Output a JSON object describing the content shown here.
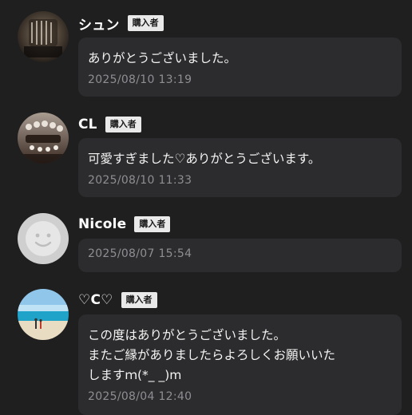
{
  "reviews": [
    {
      "user": "シュン",
      "badge": "購入者",
      "message": "ありがとうございました。",
      "timestamp": "2025/08/10 13:19",
      "avatar": "photo-icon"
    },
    {
      "user": "CL",
      "badge": "購入者",
      "message": "可愛すぎました♡ありがとうございます。",
      "timestamp": "2025/08/10 11:33",
      "avatar": "photo-icon"
    },
    {
      "user": "Nicole",
      "badge": "購入者",
      "message": "",
      "timestamp": "2025/08/07 15:54",
      "avatar": "default-avatar-icon"
    },
    {
      "user": "♡C♡",
      "badge": "購入者",
      "message": "この度はありがとうございました。\nまたご縁がありましたらよろしくお願いいた\nしますｍ(*_ _)m",
      "timestamp": "2025/08/04 12:40",
      "avatar": "beach-photo-icon"
    }
  ],
  "colors": {
    "background": "#1f1f1f",
    "bubble": "#2c2c2e",
    "badge": "#e9e9e9",
    "timestamp": "#8e8e93"
  }
}
